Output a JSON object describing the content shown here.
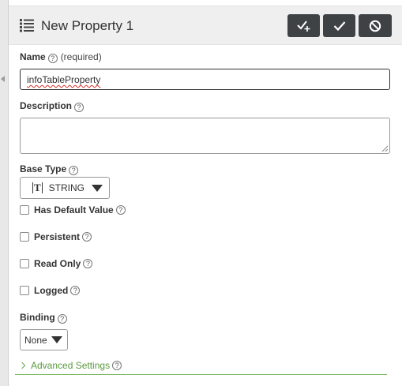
{
  "header": {
    "title": "New Property 1",
    "icons": {
      "list": "list-icon",
      "done_add": "check-plus-icon",
      "done": "check-icon",
      "cancel": "cancel-icon"
    }
  },
  "fields": {
    "name": {
      "label": "Name",
      "note": "(required)",
      "value": "infoTableProperty",
      "placeholder": ""
    },
    "description": {
      "label": "Description",
      "value": ""
    },
    "base_type": {
      "label": "Base Type",
      "icon": "T",
      "value": "STRING"
    }
  },
  "checkboxes": [
    {
      "label": "Has Default Value",
      "checked": false
    },
    {
      "label": "Persistent",
      "checked": false
    },
    {
      "label": "Read Only",
      "checked": false
    },
    {
      "label": "Logged",
      "checked": false
    }
  ],
  "binding": {
    "label": "Binding",
    "value": "None"
  },
  "advanced": {
    "label": "Advanced Settings"
  },
  "help_glyph": "?",
  "colors": {
    "header_bg": "#efefef",
    "button_bg": "#3e4245",
    "accent_green": "#5a9a3e"
  }
}
